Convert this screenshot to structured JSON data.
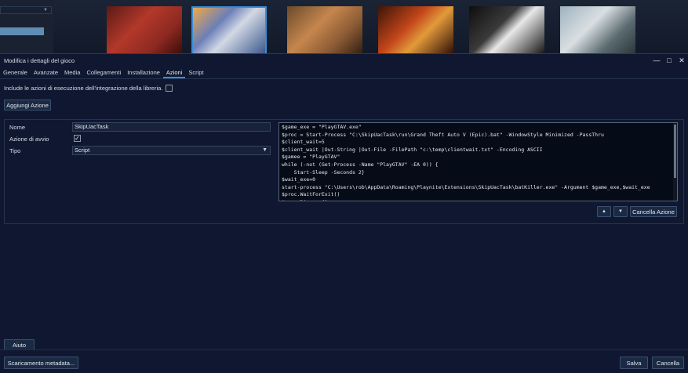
{
  "background": {
    "covers": [
      "max-payne-cover",
      "gta-v-cover",
      "max-payne-3-cover",
      "borderlands-cover",
      "max-payne-2-cover",
      "splinter-cell-cover"
    ]
  },
  "dialog": {
    "title": "Modifica i dettagli del gioco",
    "window_buttons": {
      "minimize": "—",
      "maximize": "□",
      "close": "✕"
    },
    "tabs": [
      "Generale",
      "Avanzate",
      "Media",
      "Collegamenti",
      "Installazione",
      "Azioni",
      "Script"
    ],
    "active_tab": "Azioni",
    "include_actions_label": "Include le azioni di esecuzione dell'integrazione della libreria.",
    "include_actions_checked": false,
    "add_action_button": "Aggiungi Azione",
    "action": {
      "name_label": "Nome",
      "name_value": "SkipUacTask",
      "play_action_label": "Azione di avvio",
      "play_action_checked": true,
      "type_label": "Tipo",
      "type_value": "Script"
    },
    "script_text": "$game_exe = \"PlayGTAV.exe\"\n$proc = Start-Process \"C:\\SkipUacTask\\run\\Grand Theft Auto V (Epic).bat\" -WindowStyle Minimized -PassThru\n$client_wait=5\n$client_wait |Out-String |Out-File -FilePath \"c:\\temp\\clientwait.txt\" -Encoding ASCII\n$gamee = \"PlayGTAV\"\nwhile (-not (Get-Process -Name \"PlayGTAV\" -EA 0)) {\n    Start-Sleep -Seconds 2}\n$wait_exe=0\nstart-process \"C:\\Users\\rob\\AppData\\Roaming\\Playnite\\Extensions\\SkipUacTask\\batKiller.exe\" -Argument $game_exe,$wait_exe\n$proc.WaitForExit()\n$proc.Dispose()\n#$game_fold = \"D:\\Epic Games\\GTAV\\PlayGTAV.exe\"",
    "move_up_button": "▲",
    "move_down_button": "▼",
    "delete_action_button": "Cancella Azione",
    "help_button": "Aiuto",
    "metadata_button": "Scaricamento metadata...",
    "save_button": "Salva",
    "cancel_button": "Cancella"
  },
  "colors": {
    "accent": "#3a8dd6",
    "dialog_bg": "#0f1830",
    "button_bg": "#1b2a44"
  }
}
